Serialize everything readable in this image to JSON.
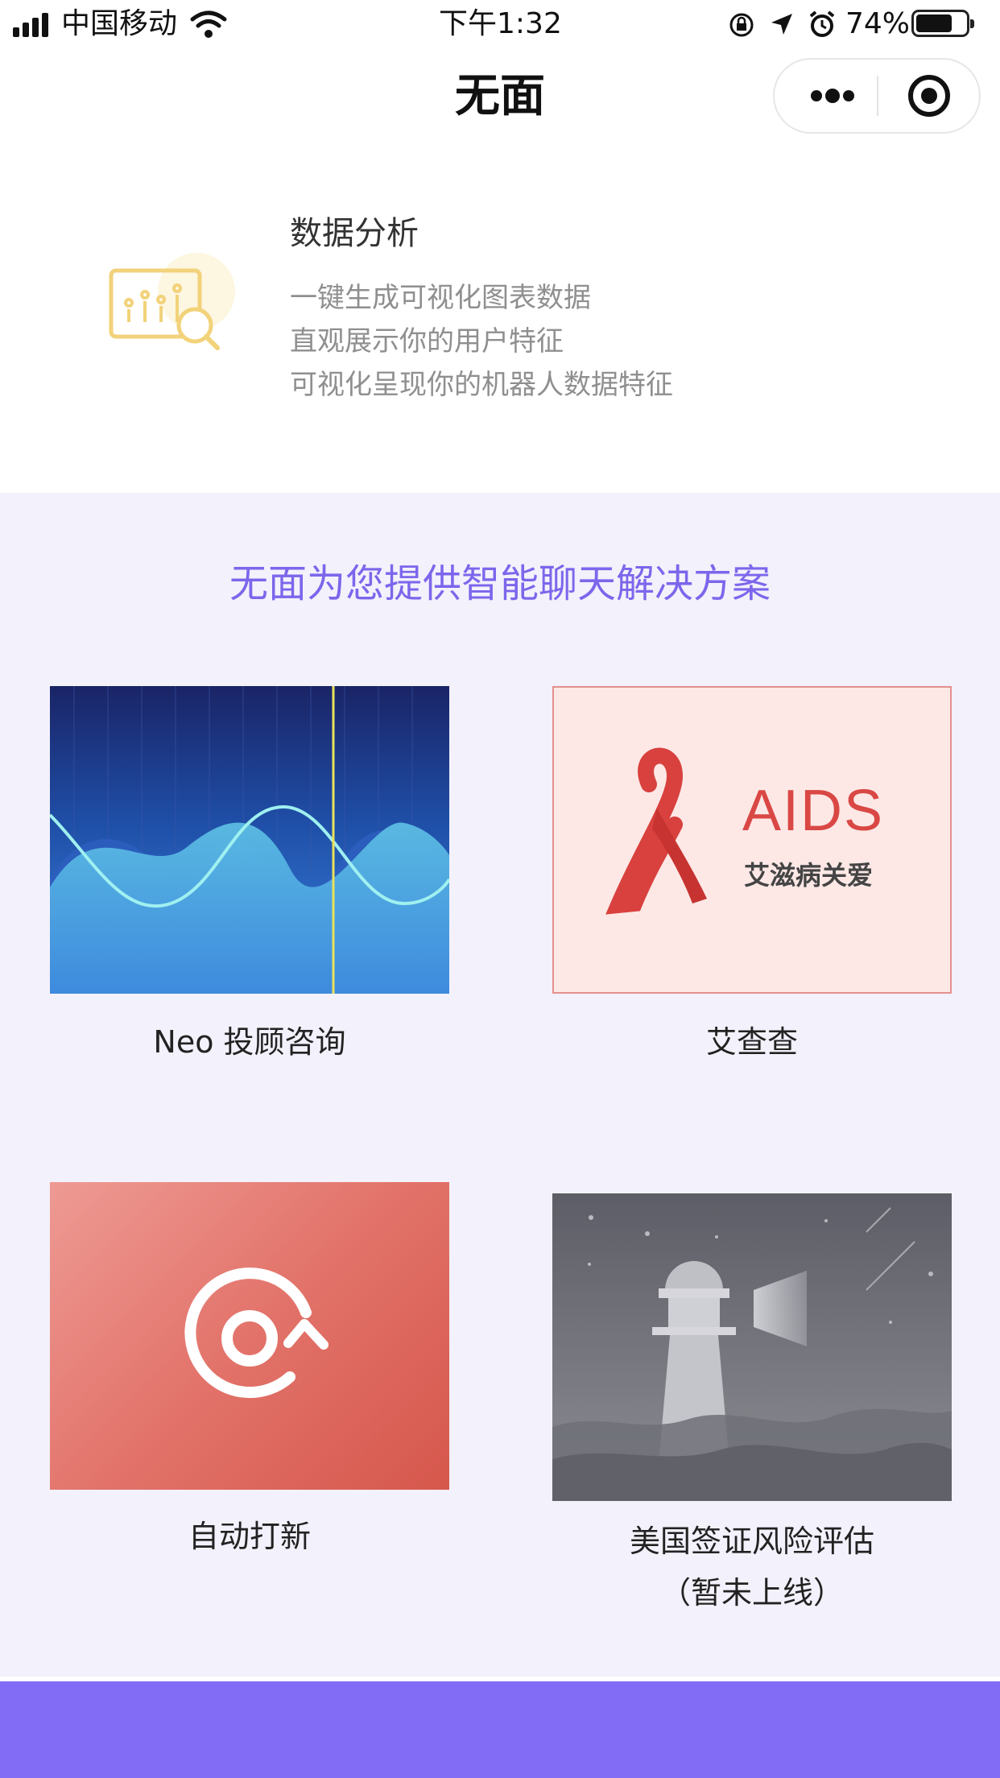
{
  "status_bar": {
    "carrier": "中国移动",
    "time": "下午1:32",
    "battery": "74%",
    "battery_level": 0.74
  },
  "nav": {
    "title": "无面",
    "more_icon": "more-dots-icon",
    "close_icon": "target-circle-icon"
  },
  "feature": {
    "title": "数据分析",
    "lines": [
      "一键生成可视化图表数据",
      "直观展示你的用户特征",
      "可视化呈现你的机器人数据特征"
    ],
    "icon": "chart-search-icon"
  },
  "section": {
    "title": "无面为您提供智能聊天解决方案",
    "cards": [
      {
        "label": "Neo 投顾咨询",
        "image": "wave-chart-image"
      },
      {
        "label": "艾查查",
        "image": "aids-ribbon-image",
        "image_title": "AIDS",
        "image_subtitle": "艾滋病关爱"
      },
      {
        "label": "自动打新",
        "image": "refresh-target-image"
      },
      {
        "label": "美国签证风险评估",
        "label_sub": "（暂未上线）",
        "image": "lighthouse-image"
      }
    ]
  },
  "colors": {
    "accent": "#7d66ec",
    "footer": "#826cf6",
    "section_bg": "#f3f1fb"
  }
}
